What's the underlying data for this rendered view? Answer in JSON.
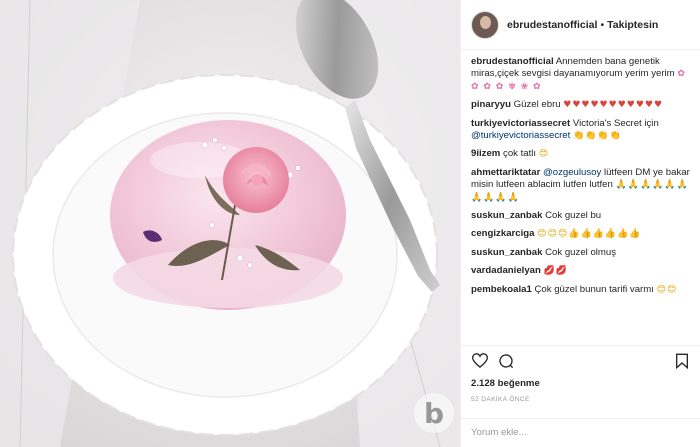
{
  "post": {
    "username": "ebrudestanofficial",
    "separator": "•",
    "follow_label": "Takiptesin"
  },
  "comments": [
    {
      "user": "ebrudestanofficial",
      "text": "Annemden bana genetik miras,çiçek sevgisi dayanamıyorum yerim yerim",
      "emoji": "✿ ✿ ✿ ✿ ✾ ❀ ✿"
    },
    {
      "user": "pinaryyu",
      "text": "Güzel ebru",
      "emoji": "♥♥♥♥♥♥♥♥♥♥♥"
    },
    {
      "user": "turkiyevictoriassecret",
      "text": "Victoria's Secret için",
      "mention": "@turkiyevictoriassecret",
      "emoji": "👏👏👏👏"
    },
    {
      "user": "9iizem",
      "text": "çok tatlı",
      "emoji": "😍"
    },
    {
      "user": "ahmettariktatar",
      "mention": "@ozgeulusoy",
      "text": "lütfeen DM ye bakar misin lutfeen ablacim lutfen lutfen",
      "emoji": "🙏🙏🙏🙏🙏🙏🙏🙏🙏🙏"
    },
    {
      "user": "suskun_zanbak",
      "text": "Cok guzel bu"
    },
    {
      "user": "cengizkarciga",
      "text": "",
      "emoji": "😊😊😊👍👍👍👍👍👍"
    },
    {
      "user": "suskun_zanbak",
      "text": "Cok guzel olmuş"
    },
    {
      "user": "vardadanielyan",
      "text": "",
      "emoji": "💋💋"
    },
    {
      "user": "pembekoala1",
      "text": "Çok güzel bunun tarifi varmı",
      "emoji": "😊😊"
    }
  ],
  "stats": {
    "likes": "2.128 beğenme",
    "time": "52 DAKİKA ÖNCE"
  },
  "comment_box": {
    "placeholder": "Yorum ekle..."
  },
  "watermark": "b",
  "icons": [
    "heart-icon",
    "comment-icon",
    "bookmark-icon"
  ],
  "colors": {
    "link": "#003569",
    "muted": "#999999",
    "border": "#efefef"
  }
}
